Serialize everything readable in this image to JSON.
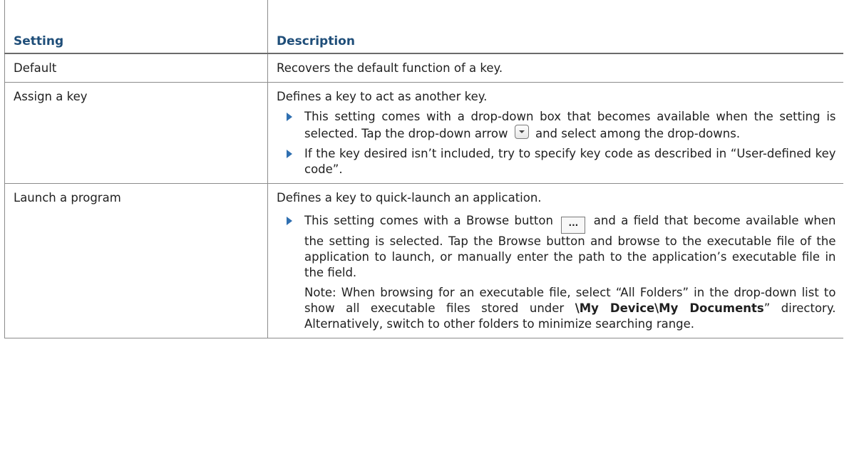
{
  "table": {
    "headers": {
      "setting": "Setting",
      "description": "Description"
    },
    "rows": [
      {
        "setting": "Default",
        "description": "Recovers the default function of a key."
      },
      {
        "setting": "Assign a key",
        "description": "Defines a key to act as another key.",
        "bullets": [
          {
            "before": "This setting comes with a drop-down box that becomes available when the setting is selected. Tap the drop-down arrow",
            "icon": "dropdown-arrow-icon",
            "after": "and select among the drop-downs."
          },
          {
            "text": "If the key desired isn’t included, try to specify key code as described in “User-defined key code”."
          }
        ]
      },
      {
        "setting": "Launch a program",
        "description": "Defines a key to quick-launch an application.",
        "bullets": [
          {
            "before": "This setting comes with a Browse button",
            "icon": "browse-button-icon",
            "icon_label": "...",
            "after": "and a field that become available when the setting is selected. Tap the Browse button and browse to the executable file of the application to launch, or manually enter the path to the application’s executable file in the field."
          }
        ],
        "note": {
          "prefix": "Note: When browsing for an executable file, select “All Folders” in the drop-down list to show all executable files stored under",
          "path": "\\My Device\\My Documents",
          "suffix": "” directory. Alternatively, switch to other folders to minimize searching range."
        }
      }
    ]
  },
  "colors": {
    "header_text": "#1f4e79",
    "bullet_arrow": "#2f6fb0",
    "border": "#8c8c8c"
  }
}
